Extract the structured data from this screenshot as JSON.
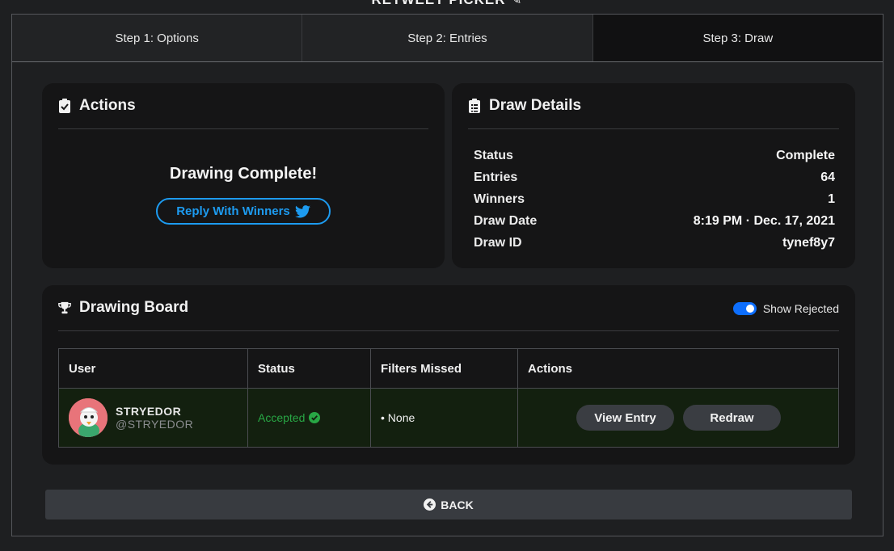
{
  "app": {
    "title": "RETWEET PICKER"
  },
  "steps": [
    {
      "label": "Step 1: Options",
      "active": false
    },
    {
      "label": "Step 2: Entries",
      "active": false
    },
    {
      "label": "Step 3: Draw",
      "active": true
    }
  ],
  "actions": {
    "heading": "Actions",
    "status_title": "Drawing Complete!",
    "reply_label": "Reply With Winners"
  },
  "details": {
    "heading": "Draw Details",
    "rows": [
      {
        "label": "Status",
        "value": "Complete"
      },
      {
        "label": "Entries",
        "value": "64"
      },
      {
        "label": "Winners",
        "value": "1"
      },
      {
        "label": "Draw Date",
        "value": "8:19 PM · Dec. 17, 2021"
      },
      {
        "label": "Draw ID",
        "value": "tynef8y7"
      }
    ]
  },
  "board": {
    "heading": "Drawing Board",
    "toggle_label": "Show Rejected",
    "toggle_on": true,
    "columns": [
      "User",
      "Status",
      "Filters Missed",
      "Actions"
    ],
    "rows": [
      {
        "name": "STRYEDOR",
        "handle": "@STRYEDOR",
        "status": "Accepted",
        "filters": "• None",
        "view_label": "View Entry",
        "redraw_label": "Redraw"
      }
    ]
  },
  "back_label": "BACK",
  "colors": {
    "accent": "#1d9bf0",
    "success": "#28a745",
    "toggle": "#0d6efd"
  }
}
